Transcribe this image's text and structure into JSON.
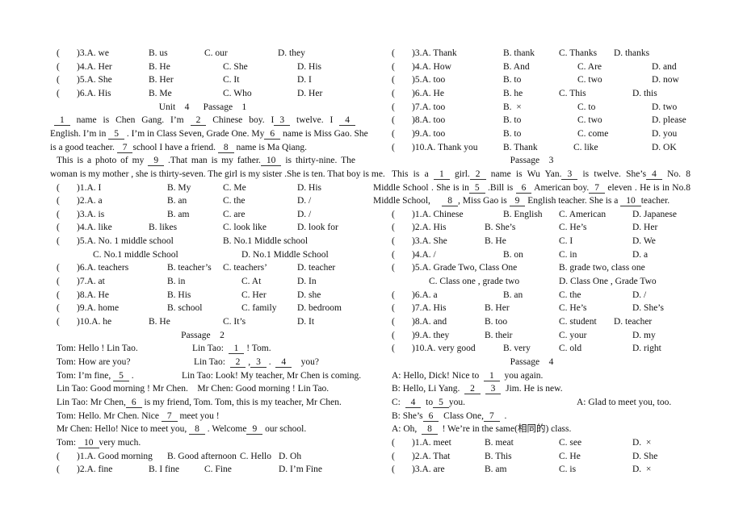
{
  "left": {
    "lines": [
      {
        "options": [
          "(",
          ")3.A. we",
          "B. us",
          "C. our",
          "D. they"
        ]
      },
      {
        "options": [
          "(",
          ")4.A. Her",
          "B. He",
          "C. She",
          "D. His"
        ]
      },
      {
        "options": [
          "(",
          ")5.A. She",
          "B. Her",
          "C. It",
          "D. I"
        ]
      },
      {
        "options": [
          "(",
          ")6.A. His",
          "B. Me",
          "C. Who",
          "D. Her"
        ]
      },
      {
        "parts": [
          {
            "segs": [
              [
                "t",
                "Unit    4      Passage    1"
              ]
            ]
          }
        ]
      },
      {
        "parts": [
          {
            "segs": [
              [
                "b",
                "1"
              ],
              [
                "t",
                " name is Chen Gang. I’m "
              ],
              [
                "b",
                "2"
              ],
              [
                "t",
                " Chinese boy. I"
              ],
              [
                "b",
                "3"
              ],
              [
                "t",
                " twelve. I "
              ],
              [
                "b",
                "4"
              ]
            ]
          }
        ]
      },
      {
        "parts": [
          {
            "segs": [
              [
                "t",
                "English. I’m in "
              ],
              [
                "b",
                "5"
              ],
              [
                "t",
                " . I’m in Class Seven, Grade One. My"
              ],
              [
                "b",
                "6"
              ],
              [
                "t",
                " name is Miss Gao. She"
              ]
            ]
          }
        ]
      },
      {
        "parts": [
          {
            "segs": [
              [
                "t",
                "is a good teacher. "
              ],
              [
                "b",
                "7"
              ],
              [
                "t",
                "school I have a friend. "
              ],
              [
                "b",
                "8"
              ],
              [
                "t",
                " name is Ma Qiang."
              ]
            ]
          }
        ]
      },
      {
        "parts": [
          {
            "segs": [
              [
                "t",
                "This is a photo of my "
              ],
              [
                "b",
                "9"
              ],
              [
                "t",
                " .That man is my father."
              ],
              [
                "b",
                "10"
              ],
              [
                "t",
                " is thirty-nine. The"
              ]
            ]
          }
        ]
      },
      {
        "parts": [
          {
            "segs": [
              [
                "t",
                "woman is my mother , she is thirty-seven. The girl is my sister .She is ten. That boy is me."
              ]
            ]
          }
        ]
      },
      {
        "options": [
          "(",
          ")1.A. I",
          "B. My",
          "C. Me",
          "D. His"
        ]
      },
      {
        "options": [
          "(",
          ")2.A. a",
          "B. an",
          "C. the",
          "D. /"
        ]
      },
      {
        "options": [
          "(",
          ")3.A. is",
          "B. am",
          "C. are",
          "D. /"
        ]
      },
      {
        "options": [
          "(",
          ")4.A. like",
          "B. likes",
          "C. look like",
          "D. look for"
        ]
      },
      {
        "options": [
          "(",
          ")5.A. No. 1 middle school",
          "B. No.1 Middle school"
        ]
      },
      {
        "options": [
          "C. No.1 middle School",
          "D. No.1 Middle School"
        ]
      },
      {
        "options": [
          "(",
          ")6.A. teachers",
          "B. teacher’s",
          "C. teachers’",
          "D. teacher"
        ]
      },
      {
        "options": [
          "(",
          ")7.A. at",
          "B. in",
          "C. At",
          "D. In"
        ]
      },
      {
        "options": [
          "(",
          ")8.A. He",
          "B. His",
          "C. Her",
          "D. she"
        ]
      },
      {
        "options": [
          "(",
          ")9.A. home",
          "B. school",
          "C. family",
          "D. bedroom"
        ]
      },
      {
        "options": [
          "(",
          ")10.A. he",
          "B. He",
          "C. It’s",
          "D. It"
        ]
      },
      {
        "parts": [
          {
            "segs": [
              [
                "t",
                "Passage    2"
              ]
            ]
          }
        ]
      },
      {
        "parts": [
          {
            "segs": [
              [
                "t",
                "Tom: Hello ! Lin Tao."
              ]
            ]
          },
          {
            "segs": [
              [
                "t",
                "Lin Tao:  "
              ],
              [
                "b",
                "1"
              ],
              [
                "t",
                " ! Tom."
              ]
            ]
          }
        ]
      },
      {
        "parts": [
          {
            "segs": [
              [
                "t",
                "Tom: How are you?"
              ]
            ]
          },
          {
            "segs": [
              [
                "t",
                "Lin Tao:  "
              ],
              [
                "b",
                "2"
              ],
              [
                "t",
                " ,"
              ],
              [
                "b",
                "3"
              ],
              [
                "t",
                " .  "
              ],
              [
                "b",
                "4"
              ],
              [
                "t",
                "    you?"
              ]
            ]
          }
        ]
      },
      {
        "parts": [
          {
            "segs": [
              [
                "t",
                "Tom: I’m fine, "
              ],
              [
                "b",
                "5"
              ],
              [
                "t",
                " ."
              ]
            ]
          },
          {
            "segs": [
              [
                "t",
                "Lin Tao: Look! My teacher, Mr Chen is coming."
              ]
            ]
          }
        ]
      },
      {
        "parts": [
          {
            "segs": [
              [
                "t",
                "Lin Tao: Good morning ! Mr Chen.    Mr Chen: Good morning ! Lin Tao."
              ]
            ]
          }
        ]
      },
      {
        "parts": [
          {
            "segs": [
              [
                "t",
                "Lin Tao: Mr Chen,"
              ],
              [
                "b",
                "6"
              ],
              [
                "t",
                " is my friend, Tom. Tom, this is my teacher, Mr Chen."
              ]
            ]
          }
        ]
      },
      {
        "parts": [
          {
            "segs": [
              [
                "t",
                "Tom: Hello. Mr Chen. Nice "
              ],
              [
                "b",
                "7"
              ],
              [
                "t",
                " meet you !"
              ]
            ]
          }
        ]
      },
      {
        "parts": [
          {
            "segs": [
              [
                "t",
                "Mr Chen: Hello! Nice to meet you, "
              ],
              [
                "b",
                "8"
              ],
              [
                "t",
                " . Welcome"
              ],
              [
                "b",
                "9"
              ],
              [
                "t",
                " our school."
              ]
            ]
          }
        ]
      },
      {
        "parts": [
          {
            "segs": [
              [
                "t",
                "Tom: "
              ],
              [
                "b",
                "10"
              ],
              [
                "t",
                "very much."
              ]
            ]
          }
        ]
      },
      {
        "options": [
          "(",
          ")1.A. Good morning",
          "B. Good afternoon",
          "C. Hello",
          "D. Oh"
        ]
      },
      {
        "options": [
          "(",
          ")2.A. fine",
          "B. I fine",
          "C. Fine",
          "D. I’m Fine"
        ]
      }
    ]
  },
  "right": {
    "lines": [
      {
        "options": [
          "(",
          ")3.A. Thank",
          "B. thank",
          "C. Thanks",
          "D. thanks"
        ]
      },
      {
        "options": [
          "(",
          ")4.A. How",
          "B. And",
          "C. Are",
          "D. and"
        ]
      },
      {
        "options": [
          "(",
          ")5.A. too",
          "B. to",
          "C. two",
          "D. now"
        ]
      },
      {
        "options": [
          "(",
          ")6.A. He",
          "B. he",
          "C. This",
          "D. this"
        ]
      },
      {
        "options": [
          "(",
          ")7.A. too",
          "B.  ×",
          "C. to",
          "D. two"
        ]
      },
      {
        "options": [
          "(",
          ")8.A. too",
          "B. to",
          "C. two",
          "D. please"
        ]
      },
      {
        "options": [
          "(",
          ")9.A. too",
          "B. to",
          "C. come",
          "D. you"
        ]
      },
      {
        "options": [
          "(",
          ")10.A. Thank you",
          "B. Thank",
          "C. like",
          "D. OK"
        ]
      },
      {
        "parts": [
          {
            "segs": [
              [
                "t",
                "Passage    3"
              ]
            ]
          }
        ]
      },
      {
        "parts": [
          {
            "segs": [
              [
                "t",
                "This is a "
              ],
              [
                "b",
                "1"
              ],
              [
                "t",
                " girl."
              ],
              [
                "b",
                "2"
              ],
              [
                "t",
                " name is Wu Yan."
              ],
              [
                "b",
                "3"
              ],
              [
                "t",
                " is twelve. She’s"
              ],
              [
                "b",
                "4"
              ],
              [
                "t",
                " No. 8"
              ]
            ]
          }
        ]
      },
      {
        "parts": [
          {
            "segs": [
              [
                "t",
                "Middle School . She is in"
              ],
              [
                "b",
                "5"
              ],
              [
                "t",
                " .Bill is "
              ],
              [
                "b",
                "6"
              ],
              [
                "t",
                " American boy."
              ],
              [
                "b",
                "7"
              ],
              [
                "t",
                " eleven . He is in No.8"
              ]
            ]
          }
        ]
      },
      {
        "parts": [
          {
            "segs": [
              [
                "t",
                "Middle School,     "
              ],
              [
                "b",
                "8"
              ],
              [
                "t",
                ", Miss Gao is "
              ],
              [
                "b",
                "9"
              ],
              [
                "t",
                " English teacher. She is a "
              ],
              [
                "b",
                "10"
              ],
              [
                "t",
                "teacher."
              ]
            ]
          }
        ]
      },
      {
        "options": [
          "(",
          ")1.A. Chinese",
          "B. English",
          "C. American",
          "D. Japanese"
        ]
      },
      {
        "options": [
          "(",
          ")2.A. His",
          "B. She’s",
          "C. He’s",
          "D. Her"
        ]
      },
      {
        "options": [
          "(",
          ")3.A. She",
          "B. He",
          "C. I",
          "D. We"
        ]
      },
      {
        "options": [
          "(",
          ")4.A. /",
          "B. on",
          "C. in",
          "D. a"
        ]
      },
      {
        "options": [
          "(",
          ")5.A. Grade Two, Class One",
          "B. grade two, class one"
        ]
      },
      {
        "options": [
          "C. Class one , grade two",
          "D. Class One , Grade Two"
        ]
      },
      {
        "options": [
          "(",
          ")6.A. a",
          "B. an",
          "C. the",
          "D. /"
        ]
      },
      {
        "options": [
          "(",
          ")7.A. His",
          "B. Her",
          "C. He’s",
          "D. She’s"
        ]
      },
      {
        "options": [
          "(",
          ")8.A. and",
          "B. too",
          "C. student",
          "D. teacher"
        ]
      },
      {
        "options": [
          "(",
          ")9.A. they",
          "B. their",
          "C. your",
          "D. my"
        ]
      },
      {
        "options": [
          "(",
          ")10.A. very good",
          "B. very",
          "C. old",
          "D. right"
        ]
      },
      {
        "parts": [
          {
            "segs": [
              [
                "t",
                "Passage    4"
              ]
            ]
          }
        ]
      },
      {
        "parts": [
          {
            "segs": [
              [
                "t",
                "A: Hello, Dick! Nice to  "
              ],
              [
                "b",
                "1"
              ],
              [
                "t",
                "  you again."
              ]
            ]
          }
        ]
      },
      {
        "parts": [
          {
            "segs": [
              [
                "t",
                "B: Hello, Li Yang.  "
              ],
              [
                "b",
                "2"
              ],
              [
                "t",
                "  "
              ],
              [
                "b",
                "3"
              ],
              [
                "t",
                "  Jim. He is new."
              ]
            ]
          }
        ]
      },
      {
        "parts": [
          {
            "segs": [
              [
                "t",
                "C:  "
              ],
              [
                "b",
                "4"
              ],
              [
                "t",
                "  to"
              ],
              [
                "b",
                "5"
              ],
              [
                "t",
                "you."
              ]
            ]
          },
          {
            "segs": [
              [
                "t",
                "A: Glad to meet you, too."
              ]
            ]
          }
        ]
      },
      {
        "parts": [
          {
            "segs": [
              [
                "t",
                "B: She’s"
              ],
              [
                "b",
                "6"
              ],
              [
                "t",
                "  Class One,"
              ],
              [
                "b",
                "7"
              ],
              [
                "t",
                "  ."
              ]
            ]
          }
        ]
      },
      {
        "parts": [
          {
            "segs": [
              [
                "t",
                "A: Oh,  "
              ],
              [
                "b",
                "8"
              ],
              [
                "t",
                "  ! We’re in the same(相同的) class."
              ]
            ]
          }
        ]
      },
      {
        "options": [
          "(",
          ")1.A. meet",
          "B. meat",
          "C. see",
          "D.  ×"
        ]
      },
      {
        "options": [
          "(",
          ")2.A. That",
          "B. This",
          "C. He",
          "D. She"
        ]
      },
      {
        "options": [
          "(",
          ")3.A. are",
          "B. am",
          "C. is",
          "D.  ×"
        ]
      }
    ]
  }
}
